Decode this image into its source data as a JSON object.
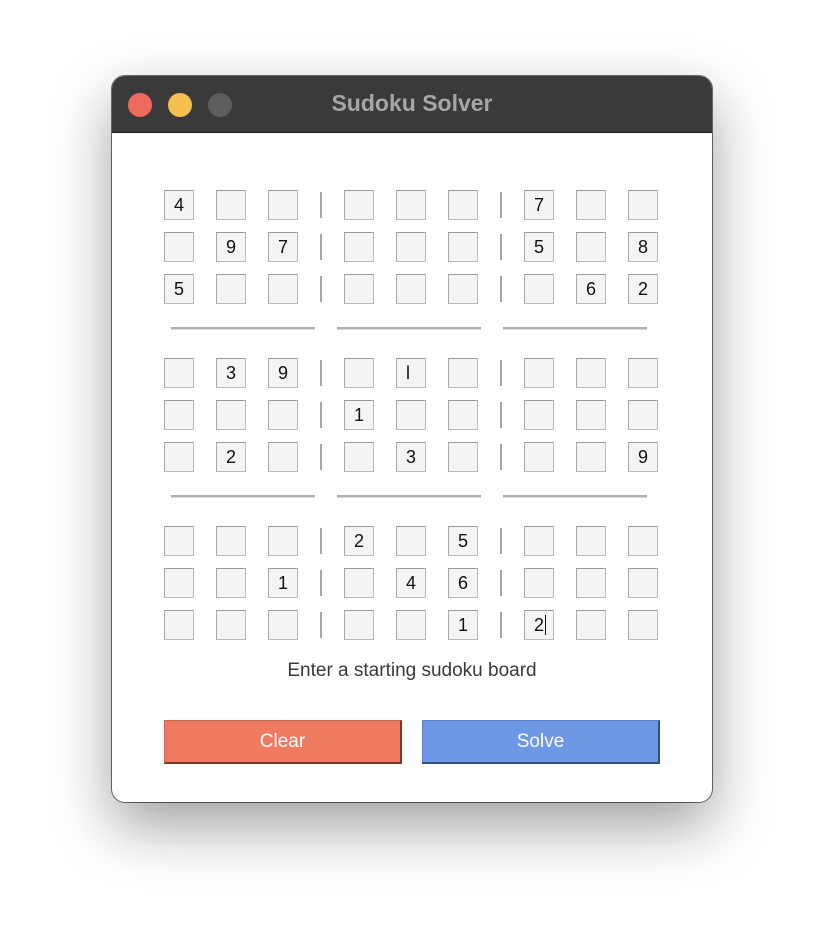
{
  "window": {
    "title": "Sudoku Solver"
  },
  "board": {
    "rows": [
      [
        "4",
        "",
        "",
        "",
        "",
        "",
        "7",
        "",
        ""
      ],
      [
        "",
        "9",
        "7",
        "",
        "",
        "",
        "5",
        "",
        "8"
      ],
      [
        "5",
        "",
        "",
        "",
        "",
        "",
        "",
        "6",
        "2"
      ],
      [
        "",
        "3",
        "9",
        "",
        "l",
        "",
        "",
        "",
        ""
      ],
      [
        "",
        "",
        "",
        "1",
        "",
        "",
        "",
        "",
        ""
      ],
      [
        "",
        "2",
        "",
        "",
        "3",
        "",
        "",
        "",
        "9"
      ],
      [
        "",
        "",
        "",
        "2",
        "",
        "5",
        "",
        "",
        ""
      ],
      [
        "",
        "",
        "1",
        "",
        "4",
        "6",
        "",
        "",
        ""
      ],
      [
        "",
        "",
        "",
        "",
        "",
        "1",
        "2",
        "",
        ""
      ]
    ],
    "focused_cell": {
      "row": 8,
      "col": 6
    }
  },
  "status": "Enter a starting sudoku board",
  "buttons": {
    "clear": "Clear",
    "solve": "Solve"
  },
  "colors": {
    "titlebar": "#3a3a3a",
    "close": "#ee6a5e",
    "minimize": "#f5bf4f",
    "maximize": "#5d5d5d",
    "clear_button": "#f07a60",
    "solve_button": "#6e98e6"
  }
}
